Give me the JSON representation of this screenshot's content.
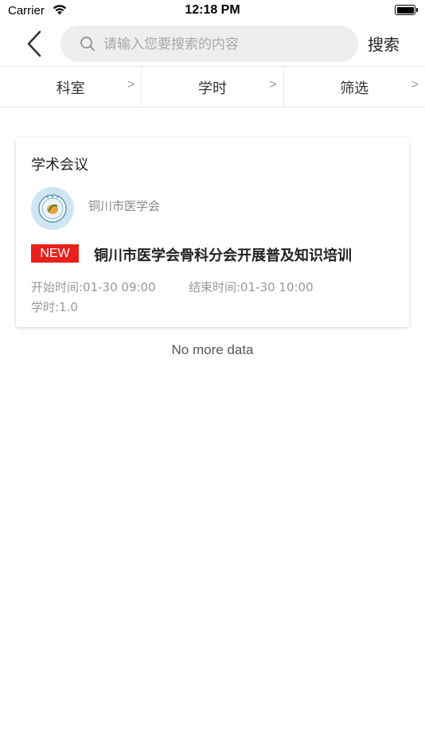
{
  "status_bar": {
    "carrier": "Carrier",
    "time": "12:18 PM"
  },
  "nav": {
    "back_icon": "chevron-left-icon",
    "search_placeholder": "请输入您要搜索的内容",
    "search_value": "",
    "search_button": "搜索"
  },
  "filters": [
    {
      "label": "科室",
      "arrow": ">"
    },
    {
      "label": "学时",
      "arrow": ">"
    },
    {
      "label": "筛选",
      "arrow": ">"
    }
  ],
  "card": {
    "category": "学术会议",
    "org_name": "铜川市医学会",
    "badge": "NEW",
    "title": "铜川市医学会骨科分会开展普及知识培训",
    "start_time": "开始时间:01-30 09:00",
    "end_time": "结束时间:01-30 10:00",
    "hours": "学时:1.0"
  },
  "footer": {
    "no_more": "No more data"
  },
  "colors": {
    "badge_red": "#e8201c",
    "search_bg": "#eeeeee",
    "muted_text": "#999999"
  }
}
